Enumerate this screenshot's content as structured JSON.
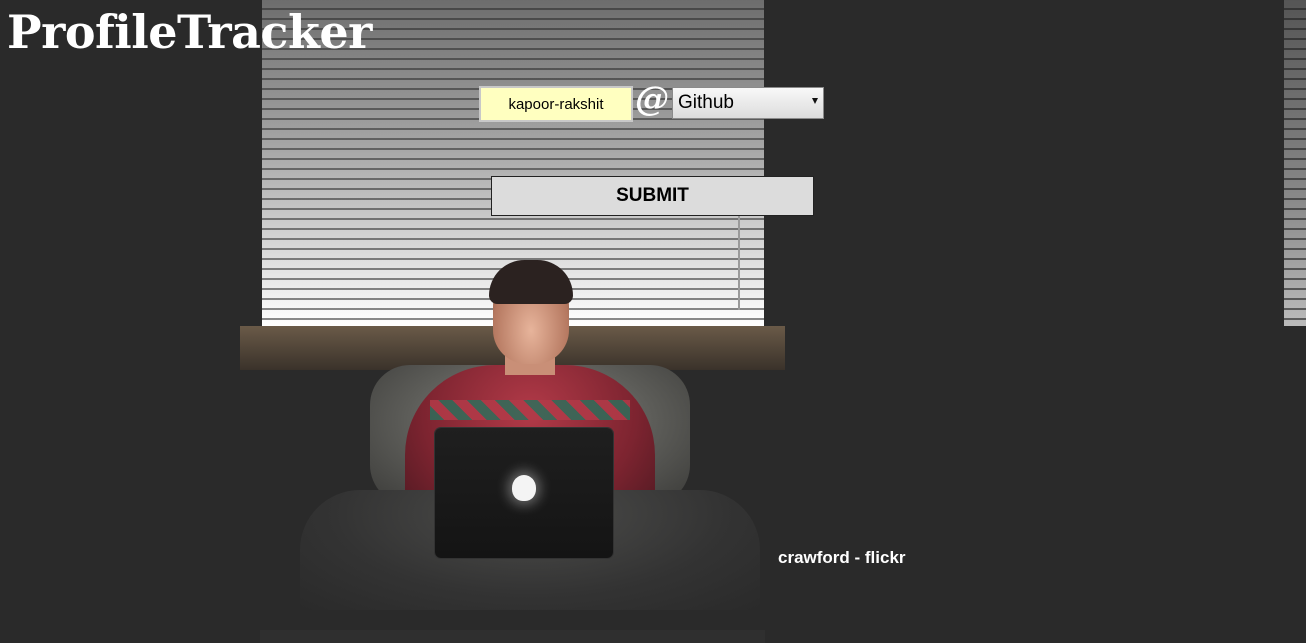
{
  "header": {
    "title": "ProfileTracker"
  },
  "form": {
    "username_value": "kapoor-rakshit",
    "separator": "@",
    "site_selected": "Github",
    "submit_label": "SUBMIT"
  },
  "footer": {
    "photo_credit": "crawford - flickr"
  },
  "colors": {
    "page_background": "#2a2a2a",
    "input_background": "#ffffc0",
    "button_background": "#dcdcdc",
    "title_text": "#ffffff"
  },
  "icons": {
    "select_arrow": "chevron-down-icon"
  }
}
